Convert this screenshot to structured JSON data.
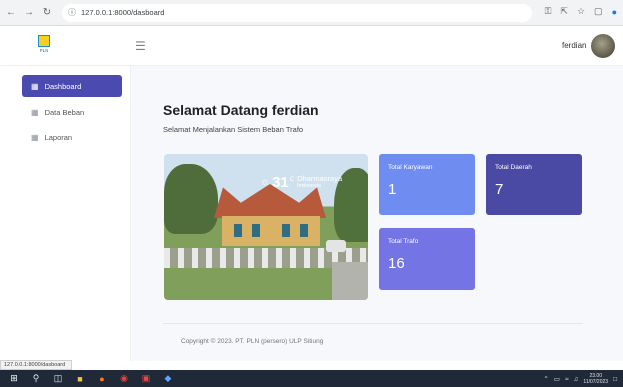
{
  "browser": {
    "url": "127.0.0.1:8000/dasboard",
    "status_url": "127.0.0.1:8000/dasboard"
  },
  "header": {
    "logo_text": "PLN",
    "username": "ferdian"
  },
  "sidebar": {
    "items": [
      {
        "label": "Dashboard",
        "active": true
      },
      {
        "label": "Data Beban",
        "active": false
      },
      {
        "label": "Laporan",
        "active": false
      }
    ]
  },
  "main": {
    "welcome": "Selamat Datang ferdian",
    "subtitle": "Selamat Menjalankan Sistem Beban Trafo",
    "weather": {
      "temp": "31",
      "unit": "C",
      "city": "Dharmasraya",
      "country": "Indonesia"
    },
    "cards": [
      {
        "label": "Total Karyawan",
        "value": "1"
      },
      {
        "label": "Total Daerah",
        "value": "7"
      },
      {
        "label": "Total Trafo",
        "value": "16"
      }
    ],
    "copyright": "Copyright © 2023. PT. PLN (persero) ULP Sitiung"
  },
  "taskbar": {
    "time": "23.00",
    "date": "11/07/2023"
  },
  "colors": {
    "sidebar_active": "#4b4ab0",
    "card_karyawan": "#6f8df0",
    "card_daerah": "#4a4aa4",
    "card_trafo": "#7474e4"
  }
}
